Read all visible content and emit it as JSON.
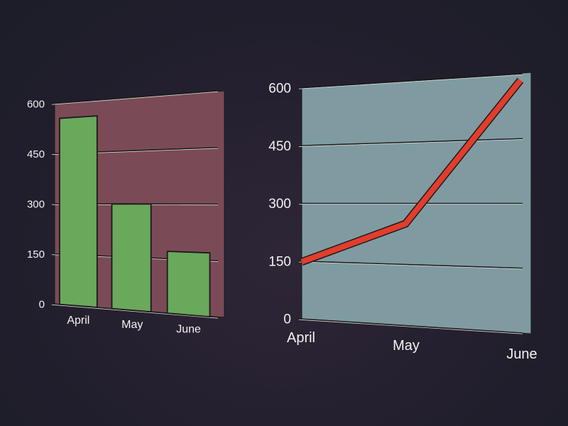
{
  "colors": {
    "left_panel": "#7b4a57",
    "bar_fill": "#6aa85c",
    "right_panel": "#7f9ba1",
    "line_stroke": "#e23d2c",
    "text": "#f2f2f2"
  },
  "chart_data": [
    {
      "type": "bar",
      "categories": [
        "April",
        "May",
        "June"
      ],
      "values": [
        555,
        300,
        170
      ],
      "ylim": [
        0,
        600
      ],
      "yticks": [
        "0",
        "150",
        "300",
        "450",
        "600"
      ],
      "grid": true
    },
    {
      "type": "line",
      "categories": [
        "April",
        "May",
        "June"
      ],
      "values": [
        148,
        250,
        585
      ],
      "ylim": [
        0,
        600
      ],
      "yticks": [
        "0",
        "150",
        "300",
        "450",
        "600"
      ],
      "grid": true
    }
  ]
}
